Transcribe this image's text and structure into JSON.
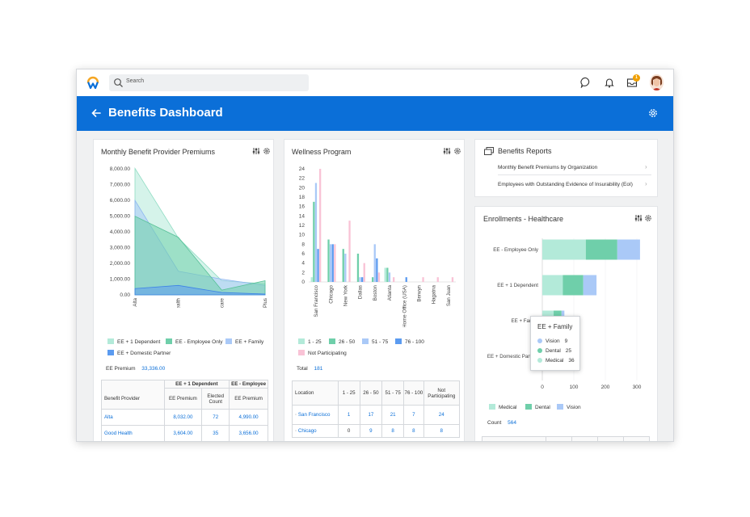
{
  "search": {
    "placeholder": "Search"
  },
  "notifications": {
    "inbox_count": "1"
  },
  "header": {
    "title": "Benefits Dashboard"
  },
  "colors": {
    "brand_blue": "#0b6fd8",
    "medical": "#b3ead9",
    "dental": "#6fcfaa",
    "vision": "#aac9f7",
    "pink": "#f9c3d6",
    "blue": "#5b9bf0"
  },
  "premiums": {
    "title": "Monthly Benefit Provider Premiums",
    "legend": [
      "EE + 1 Dependent",
      "EE - Employee Only",
      "EE + Family",
      "EE + Domestic Partner"
    ],
    "total_label": "EE Premium",
    "total_value": "33,336.00",
    "table": {
      "group_headers": [
        "EE + 1 Dependent",
        "EE - Employee"
      ],
      "col_provider": "Benefit Provider",
      "col_premium": "EE Premium",
      "col_elected": "Elected Count",
      "col_premium2": "EE Premium",
      "rows": [
        {
          "provider": "Alta",
          "premium": "8,032.00",
          "elected": "72",
          "premium2": "4,990.00"
        },
        {
          "provider": "Good Health",
          "premium": "3,604.00",
          "elected": "35",
          "premium2": "3,656.00"
        }
      ]
    }
  },
  "wellness": {
    "title": "Wellness Program",
    "legend": [
      "1 - 25",
      "26 - 50",
      "51 - 75",
      "76 - 100",
      "Not Participating"
    ],
    "total_label": "Total",
    "total_value": "181",
    "table": {
      "headers": [
        "Location",
        "1 - 25",
        "26 - 50",
        "51 - 75",
        "76 - 100",
        "Not Participating"
      ],
      "rows": [
        {
          "location": "San Francisco",
          "c1": "1",
          "c2": "17",
          "c3": "21",
          "c4": "7",
          "c5": "24"
        },
        {
          "location": "Chicago",
          "c1": "0",
          "c2": "9",
          "c3": "8",
          "c4": "8",
          "c5": "8"
        }
      ]
    }
  },
  "reports": {
    "title": "Benefits Reports",
    "items": [
      "Monthly Benefit Premiums by Organization",
      "Employees with Outstanding Evidence of Insurability (EoI)"
    ]
  },
  "enrollments": {
    "title": "Enrollments - Healthcare",
    "legend": [
      "Medical",
      "Dental",
      "Vision"
    ],
    "count_label": "Count",
    "count_value": "564",
    "tooltip": {
      "title": "EE + Family",
      "rows": [
        {
          "label": "Vision",
          "value": "9"
        },
        {
          "label": "Dental",
          "value": "25"
        },
        {
          "label": "Medical",
          "value": "36"
        }
      ]
    }
  },
  "chart_data": [
    {
      "type": "area",
      "title": "Monthly Benefit Provider Premiums",
      "categories": [
        "Alta",
        "Good Health",
        "UnitedHealthcare",
        "Vision Plus"
      ],
      "ylim": [
        0,
        8000
      ],
      "yticks": [
        "0.00",
        "1,000.00",
        "2,000.00",
        "3,000.00",
        "4,000.00",
        "5,000.00",
        "6,000.00",
        "7,000.00",
        "8,000.00"
      ],
      "series": [
        {
          "name": "EE + 1 Dependent",
          "values": [
            8032,
            3604,
            900,
            700
          ]
        },
        {
          "name": "EE - Employee Only",
          "values": [
            4990,
            3656,
            300,
            900
          ]
        },
        {
          "name": "EE + Family",
          "values": [
            6000,
            1500,
            1000,
            600
          ]
        },
        {
          "name": "EE + Domestic Partner",
          "values": [
            400,
            600,
            150,
            50
          ]
        }
      ]
    },
    {
      "type": "bar",
      "title": "Wellness Program",
      "categories": [
        "San Francisco",
        "Chicago",
        "New York",
        "Dallas",
        "Boston",
        "Atlanta",
        "Home Office (USA)",
        "Berwyn",
        "Hagatna",
        "San Juan"
      ],
      "ylim": [
        0,
        24
      ],
      "yticks": [
        "0",
        "2",
        "4",
        "6",
        "8",
        "10",
        "12",
        "14",
        "16",
        "18",
        "20",
        "22",
        "24"
      ],
      "series": [
        {
          "name": "1 - 25",
          "values": [
            1,
            0,
            0,
            0,
            0,
            3,
            0,
            0,
            0,
            0
          ]
        },
        {
          "name": "26 - 50",
          "values": [
            17,
            9,
            7,
            6,
            1,
            3,
            0,
            0,
            0,
            0
          ]
        },
        {
          "name": "51 - 75",
          "values": [
            21,
            8,
            6,
            1,
            8,
            2,
            0,
            0,
            0,
            0
          ]
        },
        {
          "name": "76 - 100",
          "values": [
            7,
            8,
            0,
            1,
            5,
            0,
            1,
            0,
            0,
            0
          ]
        },
        {
          "name": "Not Participating",
          "values": [
            24,
            8,
            13,
            4,
            2,
            1,
            0,
            1,
            1,
            1
          ]
        }
      ]
    },
    {
      "type": "bar",
      "orientation": "horizontal",
      "stacked": true,
      "title": "Enrollments - Healthcare",
      "categories": [
        "EE - Employee Only",
        "EE + 1 Dependent",
        "EE + Family",
        "EE + Domestic Partner"
      ],
      "xlim": [
        0,
        300
      ],
      "xticks": [
        "0",
        "100",
        "200",
        "300"
      ],
      "series": [
        {
          "name": "Medical",
          "values": [
            138,
            65,
            36,
            2
          ]
        },
        {
          "name": "Dental",
          "values": [
            100,
            65,
            25,
            1
          ]
        },
        {
          "name": "Vision",
          "values": [
            72,
            42,
            9,
            1
          ]
        }
      ]
    }
  ]
}
